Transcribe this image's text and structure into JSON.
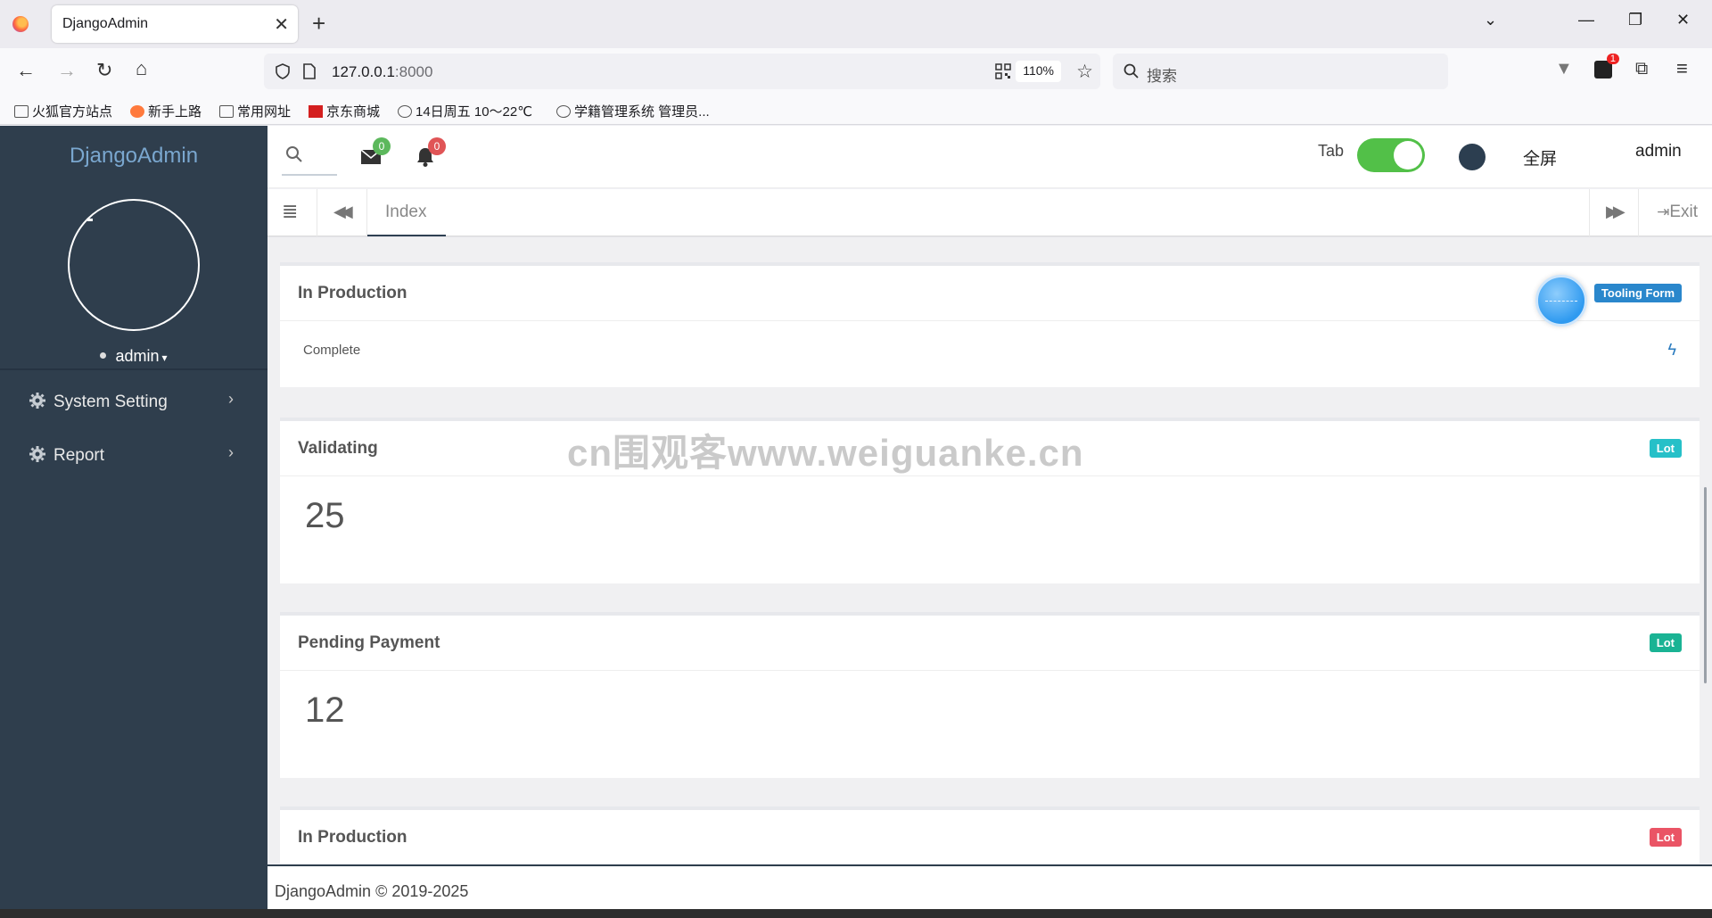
{
  "browser": {
    "tab_title": "DjangoAdmin",
    "url_host": "127.0.0.1",
    "url_port": ":8000",
    "zoom": "110%",
    "search_placeholder": "搜索",
    "notification_count": "1",
    "bookmarks": [
      "火狐官方站点",
      "新手上路",
      "常用网址",
      "京东商城",
      "14日周五  10～22℃",
      "学籍管理系统 管理员..."
    ]
  },
  "sidebar": {
    "brand": "DjangoAdmin",
    "username": "admin",
    "menu": [
      {
        "label": "System Setting"
      },
      {
        "label": "Report"
      }
    ]
  },
  "topbar": {
    "mail_count": "0",
    "notify_count": "0",
    "tab_label": "Tab",
    "fullscreen": "全屏",
    "user": "admin"
  },
  "tabbar": {
    "page_tab": "Index",
    "exit": "Exit"
  },
  "cards": [
    {
      "title": "In Production",
      "badge": "Tooling Form",
      "badge_color": "#2a87cc",
      "body": "Complete"
    },
    {
      "title": "Validating",
      "badge": "Lot",
      "badge_color": "#26c0c8",
      "value": "25"
    },
    {
      "title": "Pending Payment",
      "badge": "Lot",
      "badge_color": "#1ab394",
      "value": "12"
    },
    {
      "title": "In Production",
      "badge": "Lot",
      "badge_color": "#ea5465"
    }
  ],
  "watermark": "cn围观客www.weiguanke.cn",
  "footer": "DjangoAdmin © 2019-2025"
}
